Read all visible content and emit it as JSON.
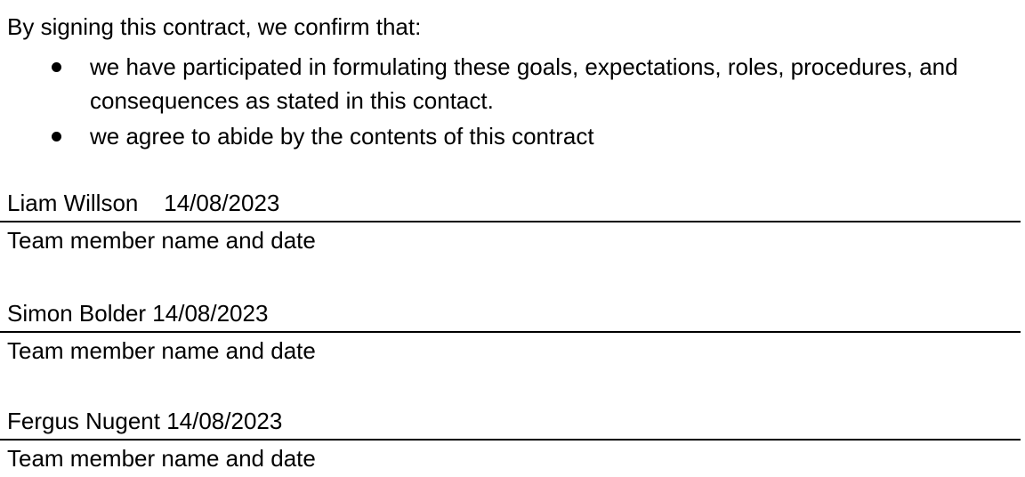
{
  "intro": "By signing this contract, we confirm that:",
  "bullets": [
    "we have participated in formulating these goals, expectations, roles, procedures, and consequences as stated in this contact.",
    "we agree to abide by the contents of this contract"
  ],
  "signatures": [
    {
      "name_line": "Liam Willson    14/08/2023",
      "caption": "Team member name and date"
    },
    {
      "name_line": "Simon Bolder 14/08/2023",
      "caption": "Team member name and date"
    },
    {
      "name_line": "Fergus Nugent 14/08/2023",
      "caption": "Team member name and date"
    }
  ]
}
